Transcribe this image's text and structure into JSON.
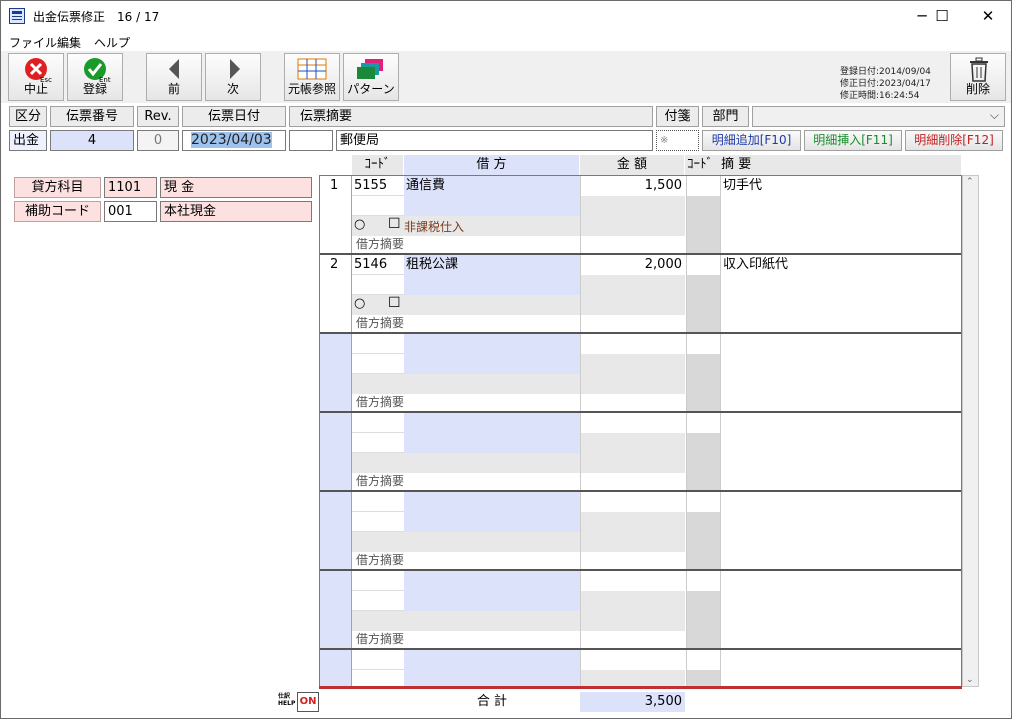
{
  "window": {
    "title": "出金伝票修正　16 / 17",
    "minimize": "─",
    "maximize": "☐",
    "close": "✕"
  },
  "menu": [
    "ファイル",
    "編集",
    "ヘルプ"
  ],
  "toolbar": {
    "cancel": {
      "label": "中止",
      "key": "Esc"
    },
    "save": {
      "label": "登録",
      "key": "Ent"
    },
    "prev": "前",
    "next": "次",
    "ledger": "元帳参照",
    "pattern": "パターン",
    "delete": "削除"
  },
  "meta": {
    "registered": "登録日付:2014/09/04",
    "modified_date": "修正日付:2023/04/17",
    "modified_time": "修正時間:16:24:54"
  },
  "header_labels": {
    "kubun": "区分",
    "number": "伝票番号",
    "rev": "Rev.",
    "date": "伝票日付",
    "summary": "伝票摘要",
    "tag": "付箋",
    "dept": "部門"
  },
  "header_values": {
    "kubun": "出金",
    "number": "4",
    "rev": "0",
    "date": "2023/04/03",
    "summary": "郵便局",
    "tag_mark": "※"
  },
  "line_buttons": {
    "add": "明細追加[F10]",
    "insert": "明細挿入[F11]",
    "delete": "明細削除[F12]"
  },
  "left_panel": {
    "credit_label": "貸方科目",
    "credit_code": "1101",
    "credit_name": "現  金",
    "sub_label": "補助コード",
    "sub_code": "001",
    "sub_name": "本社現金"
  },
  "grid_headers": {
    "code": "ｺｰﾄﾞ",
    "debit": "借  方",
    "amount": "金  額",
    "code2": "ｺｰﾄﾞ",
    "memo": "摘  要"
  },
  "rows": [
    {
      "no": "1",
      "code": "5155",
      "account": "通信費",
      "amount": "1,500",
      "memo": "切手代",
      "radio": "○",
      "checkbox": "☐",
      "tax": "非課税仕入",
      "debit_memo": "借方摘要"
    },
    {
      "no": "2",
      "code": "5146",
      "account": "租税公課",
      "amount": "2,000",
      "memo": "収入印紙代",
      "radio": "○",
      "checkbox": "☐",
      "tax": "",
      "debit_memo": "借方摘要"
    },
    {
      "no": "",
      "code": "",
      "account": "",
      "amount": "",
      "memo": "",
      "radio": "",
      "checkbox": "",
      "tax": "",
      "debit_memo": "借方摘要"
    },
    {
      "no": "",
      "code": "",
      "account": "",
      "amount": "",
      "memo": "",
      "radio": "",
      "checkbox": "",
      "tax": "",
      "debit_memo": "借方摘要"
    },
    {
      "no": "",
      "code": "",
      "account": "",
      "amount": "",
      "memo": "",
      "radio": "",
      "checkbox": "",
      "tax": "",
      "debit_memo": "借方摘要"
    },
    {
      "no": "",
      "code": "",
      "account": "",
      "amount": "",
      "memo": "",
      "radio": "",
      "checkbox": "",
      "tax": "",
      "debit_memo": "借方摘要"
    },
    {
      "no": "",
      "code": "",
      "account": "",
      "amount": "",
      "memo": "",
      "radio": "",
      "checkbox": "",
      "tax": "",
      "debit_memo": ""
    }
  ],
  "totals": {
    "help_label": "仕訳\nHELP",
    "on": "ON",
    "label": "合  計",
    "amount": "3,500"
  }
}
